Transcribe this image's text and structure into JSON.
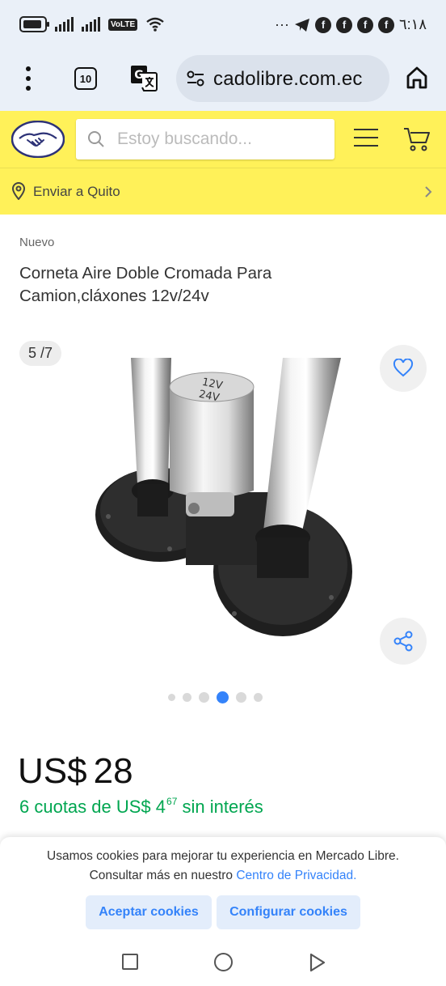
{
  "status_bar": {
    "time": "٦:١٨",
    "network_label": "VoLTE",
    "overflow": "···"
  },
  "browser": {
    "tab_count": "10",
    "url": "cadolibre.com.ec"
  },
  "header": {
    "search_placeholder": "Estoy buscando...",
    "ship_to": "Enviar a Quito",
    "brand_color": "#fff159"
  },
  "product": {
    "condition": "Nuevo",
    "title": "Corneta Aire Doble Cromada Para Camion,cláxones 12v/24v",
    "image_counter": "5 /7",
    "image_labels": [
      "12V",
      "24V"
    ],
    "gallery_total": 6,
    "gallery_active_index": 3,
    "price_currency": "US$",
    "price_value": "28",
    "installments_prefix": "6 cuotas de US$ 4",
    "installments_cents": "67",
    "installments_suffix": " sin interés"
  },
  "cookies": {
    "message": "Usamos cookies para mejorar tu experiencia en Mercado Libre. Consultar más en nuestro ",
    "link_text": "Centro de Privacidad.",
    "accept_label": "Aceptar cookies",
    "configure_label": "Configurar cookies"
  },
  "colors": {
    "accent_blue": "#3483fa",
    "green": "#00a650"
  }
}
